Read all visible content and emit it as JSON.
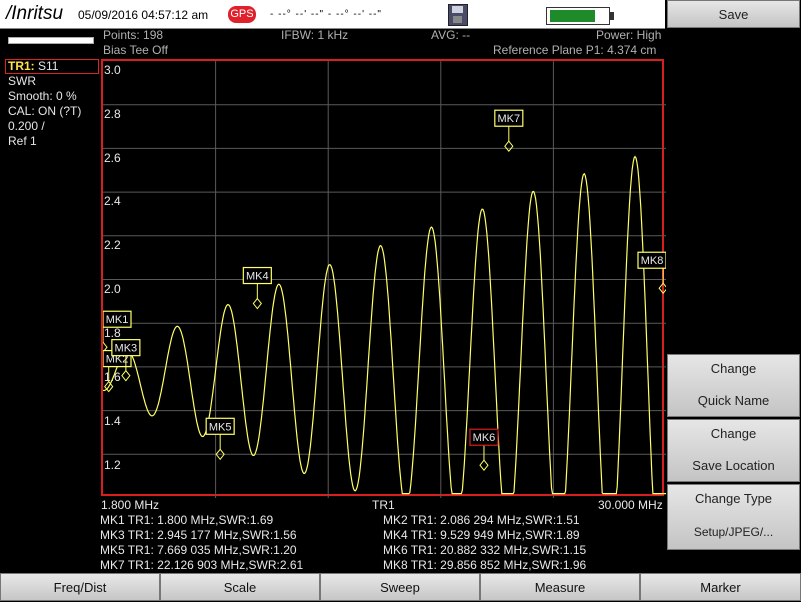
{
  "header": {
    "logo": "/Inritsu",
    "datetime": "05/09/2016 04:57:12 am",
    "gps_label": "GPS",
    "gps_coords": "- --° --' --\" - --° --' --\""
  },
  "info": {
    "points": "Points: 198",
    "ifbw": "IFBW: 1 kHz",
    "avg": "AVG: --",
    "power": "Power: High",
    "bias_tee": "Bias Tee Off",
    "ref_plane": "Reference Plane P1: 4.374 cm"
  },
  "trace_panel": {
    "trace_id": "TR1:",
    "trace_param": "S11",
    "format": "SWR",
    "smooth": "Smooth: 0 %",
    "cal": "CAL: ON (?T)",
    "scale": "0.200 /",
    "ref": "Ref 1"
  },
  "axis": {
    "y_ticks": [
      "3.0",
      "2.8",
      "2.6",
      "2.4",
      "2.2",
      "2.0",
      "1.8",
      "1.6",
      "1.4",
      "1.2"
    ],
    "x_start": "1.800 MHz",
    "x_center": "TR1",
    "x_stop": "30.000 MHz"
  },
  "markers": [
    {
      "label": "MK1 TR1:",
      "value": "1.800 MHz,SWR:1.69"
    },
    {
      "label": "MK2 TR1:",
      "value": "2.086 294 MHz,SWR:1.51"
    },
    {
      "label": "MK3 TR1:",
      "value": "2.945 177 MHz,SWR:1.56"
    },
    {
      "label": "MK4 TR1:",
      "value": "9.529 949 MHz,SWR:1.89"
    },
    {
      "label": "MK5 TR1:",
      "value": "7.669 035 MHz,SWR:1.20"
    },
    {
      "label": "MK6 TR1:",
      "value": "20.882 332 MHz,SWR:1.15"
    },
    {
      "label": "MK7 TR1:",
      "value": "22.126 903 MHz,SWR:2.61"
    },
    {
      "label": "MK8 TR1:",
      "value": "29.856 852 MHz,SWR:1.96"
    }
  ],
  "plot_markers": {
    "mk1": "MK1",
    "mk2": "MK2",
    "mk3": "MK3",
    "mk4": "MK4",
    "mk5": "MK5",
    "mk6": "MK6",
    "mk7": "MK7",
    "mk8": "MK8"
  },
  "softkeys": {
    "save": "Save",
    "change_quick_name": [
      "Change",
      "Quick Name"
    ],
    "change_save_location": [
      "Change",
      "Save Location"
    ],
    "change_type": [
      "Change Type",
      "Setup/JPEG/..."
    ]
  },
  "bottom_menu": [
    "Freq/Dist",
    "Scale",
    "Sweep",
    "Measure",
    "Marker"
  ],
  "colors": {
    "trace": "#ffff66",
    "plot_border": "#d81e1e",
    "marker_active": "#d81e1e",
    "battery": "#1f8a2a"
  }
}
